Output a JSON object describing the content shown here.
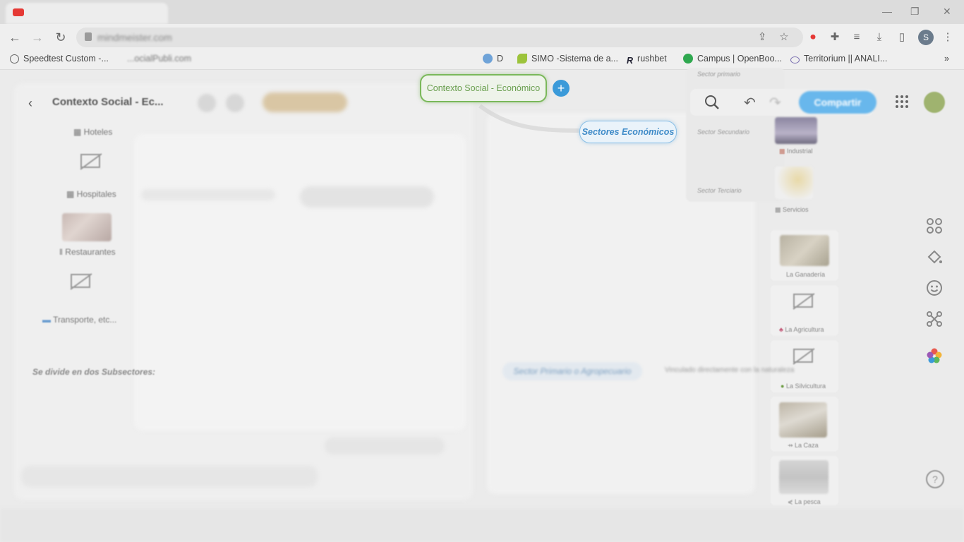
{
  "browser": {
    "bookmarks": [
      {
        "label": "Speedtest Custom -..."
      },
      {
        "label": "D"
      },
      {
        "label": "SIMO -Sistema de a..."
      },
      {
        "label": "rushbet"
      },
      {
        "label": "Campus | OpenBoo..."
      },
      {
        "label": "Territorium || ANALI..."
      }
    ],
    "bookmarks_blurred": "...ocialPubli.com",
    "more": "»",
    "profile_initial": "S"
  },
  "app": {
    "doc_title": "Contexto Social - Ec...",
    "central_node": "Contexto Social - Económico",
    "add_symbol": "+",
    "branch": "Sectores Económicos",
    "share_label": "Compartir",
    "left_nodes": [
      {
        "label": "Hoteles"
      },
      {
        "label": "Hospitales"
      },
      {
        "label": "Restaurantes"
      },
      {
        "label": "Transporte, etc..."
      }
    ],
    "subsectores_label": "Se divide en dos Subsectores:",
    "sector_labels": [
      "Sector primario",
      "Sector Secundario",
      "Sector Terciario"
    ],
    "right_nodes": [
      {
        "label": "Industrial"
      },
      {
        "label": "Servicios"
      },
      {
        "label": "La Ganadería"
      },
      {
        "label": "La Agricultura"
      },
      {
        "label": "La Silvicultura"
      },
      {
        "label": "La Caza"
      },
      {
        "label": "La pesca"
      }
    ],
    "primario_node": "Sector Primario o Agropecuario",
    "primario_desc": "Vinculado directamente con la naturaleza",
    "help": "?"
  },
  "colors": {
    "central_border": "#7ab85a",
    "branch_text": "#3f8bc8",
    "share_bg": "#68b7ec",
    "add_bg": "#3b9ad9"
  }
}
